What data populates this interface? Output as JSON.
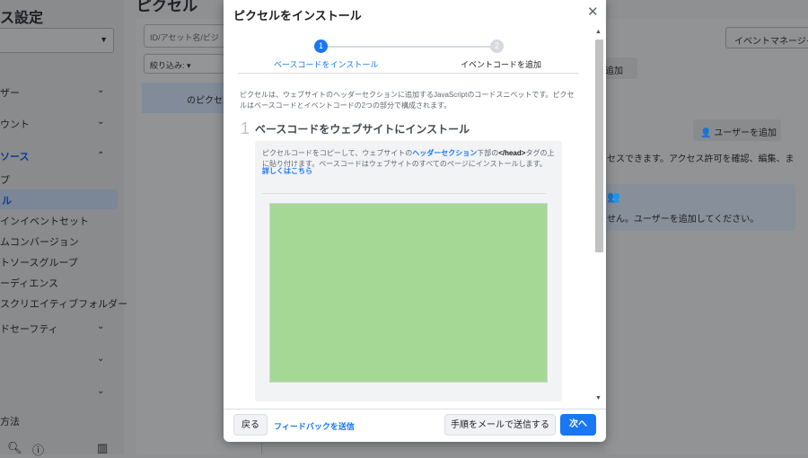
{
  "background": {
    "sidebar": {
      "title": "ス設定",
      "items": [
        {
          "label": "ザー",
          "chevron": "⌄"
        },
        {
          "label": "ウント",
          "chevron": "⌄"
        },
        {
          "label": "ソース",
          "chevron": "⌃"
        },
        {
          "label": "プ"
        },
        {
          "label": "ル"
        },
        {
          "label": "インイベントセット"
        },
        {
          "label": "ムコンバージョン"
        },
        {
          "label": "トソースグループ"
        },
        {
          "label": "ーディエンス"
        },
        {
          "label": "スクリエイティブフォルダー"
        },
        {
          "label": "ドセーフティ",
          "chevron": "⌄"
        },
        {
          "label": "",
          "chevron": "⌄"
        },
        {
          "label": "",
          "chevron": "⌄"
        },
        {
          "label": "方法"
        }
      ]
    },
    "header_title": "ピクセル",
    "search_placeholder": "ID/アセット名/ビジ",
    "filter_label": "絞り込み:",
    "pixel_row_label": "のピクセル",
    "event_manager_button": "イベントマネージャ",
    "add_button": "追加",
    "add_user_button": "ユーザーを追加",
    "access_text": "セスできます。アクセス許可を確認、編集、ま",
    "empty_text": "せん。ユーザーを追加してください。"
  },
  "modal": {
    "title": "ピクセルをインストール",
    "steps": [
      {
        "number": "1",
        "label": "ベースコードをインストール",
        "state": "active"
      },
      {
        "number": "2",
        "label": "イベントコードを追加",
        "state": "inactive"
      }
    ],
    "intro": "ピクセルは、ウェブサイトのヘッダーセクションに追加するJavaScriptのコードスニペットです。ピクセルはベースコードとイベントコードの2つの部分で構成されます。",
    "section": {
      "number": "1",
      "title": "ベースコードをウェブサイトにインストール",
      "text_before": "ピクセルコードをコピーして、ウェブサイトの",
      "text_link": "ヘッダーセクション",
      "text_mid": "下部の",
      "text_bold": "</head>",
      "text_after": "タグの上に貼り付けます。ベースコードはウェブサイトのすべてのページにインストールします。",
      "learn_more": "詳しくはこちら"
    },
    "footer": {
      "back": "戻る",
      "feedback": "フィードバックを送信",
      "email": "手順をメールで送信する",
      "next": "次へ"
    }
  },
  "colors": {
    "accent": "#1877f2",
    "code_box": "#a5d895"
  }
}
